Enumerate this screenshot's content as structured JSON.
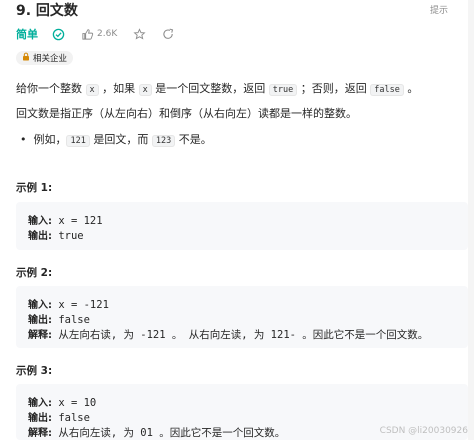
{
  "problem": {
    "title": "9. 回文数",
    "hint_label": "提示",
    "difficulty": "简单",
    "likes": "2.6K",
    "tag_label": "相关企业"
  },
  "description": {
    "p1_a": "给你一个整数 ",
    "p1_code_x": "x",
    "p1_b": " ，如果 ",
    "p1_code_x2": "x",
    "p1_c": " 是一个回文整数，返回 ",
    "p1_code_true": "true",
    "p1_d": " ；否则，返回 ",
    "p1_code_false": "false",
    "p1_e": " 。",
    "p2": "回文数是指正序（从左向右）和倒序（从右向左）读都是一样的整数。",
    "bullet_a": "例如，",
    "bullet_code_121": "121",
    "bullet_b": " 是回文，而 ",
    "bullet_code_123": "123",
    "bullet_c": " 不是。"
  },
  "examples": [
    {
      "title": "示例 1:",
      "input_label": "输入:",
      "input_value": " x = 121",
      "output_label": "输出:",
      "output_value": " true"
    },
    {
      "title": "示例 2:",
      "input_label": "输入:",
      "input_value": " x = -121",
      "output_label": "输出:",
      "output_value": " false",
      "explain_label": "解释:",
      "explain_value": " 从左向右读, 为 -121 。 从右向左读, 为 121- 。因此它不是一个回文数。"
    },
    {
      "title": "示例 3:",
      "input_label": "输入:",
      "input_value": " x = 10",
      "output_label": "输出:",
      "output_value": " false",
      "explain_label": "解释:",
      "explain_value": " 从右向左读, 为 01 。因此它不是一个回文数。"
    }
  ],
  "watermark": "CSDN @li20030926",
  "colors": {
    "easy": "#00af9b",
    "muted": "#8c8c8c",
    "code_bg": "#f7f8fa"
  }
}
